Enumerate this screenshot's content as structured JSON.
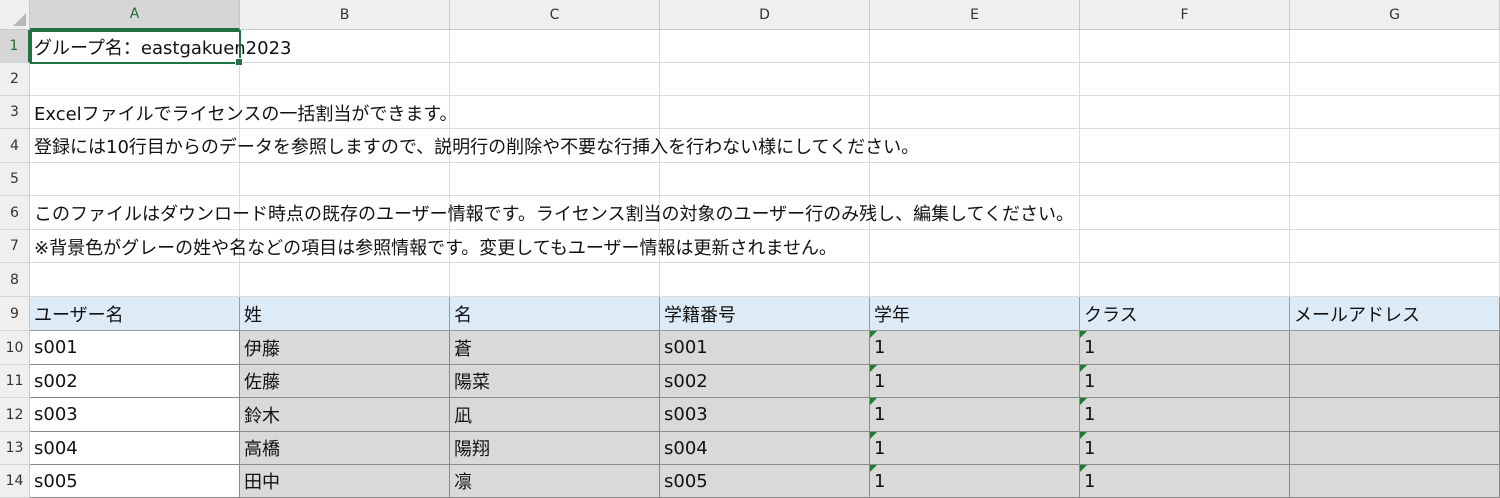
{
  "columns": [
    "A",
    "B",
    "C",
    "D",
    "E",
    "F",
    "G"
  ],
  "rows": [
    "1",
    "2",
    "3",
    "4",
    "5",
    "6",
    "7",
    "8",
    "9",
    "10",
    "11",
    "12",
    "13",
    "14"
  ],
  "lines": {
    "r1": "グループ名：eastgakuen2023",
    "r3": "Excelファイルでライセンスの一括割当ができます。",
    "r4": "登録には10行目からのデータを参照しますので、説明行の削除や不要な行挿入を行わない様にしてください。",
    "r6": "このファイルはダウンロード時点の既存のユーザー情報です。ライセンス割当の対象のユーザー行のみ残し、編集してください。",
    "r7": "※背景色がグレーの姓や名などの項目は参照情報です。変更してもユーザー情報は更新されません。"
  },
  "table": {
    "headers": [
      "ユーザー名",
      "姓",
      "名",
      "学籍番号",
      "学年",
      "クラス",
      "メールアドレス"
    ],
    "rows": [
      [
        "s001",
        "伊藤",
        "蒼",
        "s001",
        "1",
        "1",
        ""
      ],
      [
        "s002",
        "佐藤",
        "陽菜",
        "s002",
        "1",
        "1",
        ""
      ],
      [
        "s003",
        "鈴木",
        "凪",
        "s003",
        "1",
        "1",
        ""
      ],
      [
        "s004",
        "高橋",
        "陽翔",
        "s004",
        "1",
        "1",
        ""
      ],
      [
        "s005",
        "田中",
        "凛",
        "s005",
        "1",
        "1",
        ""
      ]
    ]
  },
  "colors": {
    "header_fill": "#ddebf7",
    "reference_fill": "#d9d9d9",
    "selection": "#217346"
  }
}
